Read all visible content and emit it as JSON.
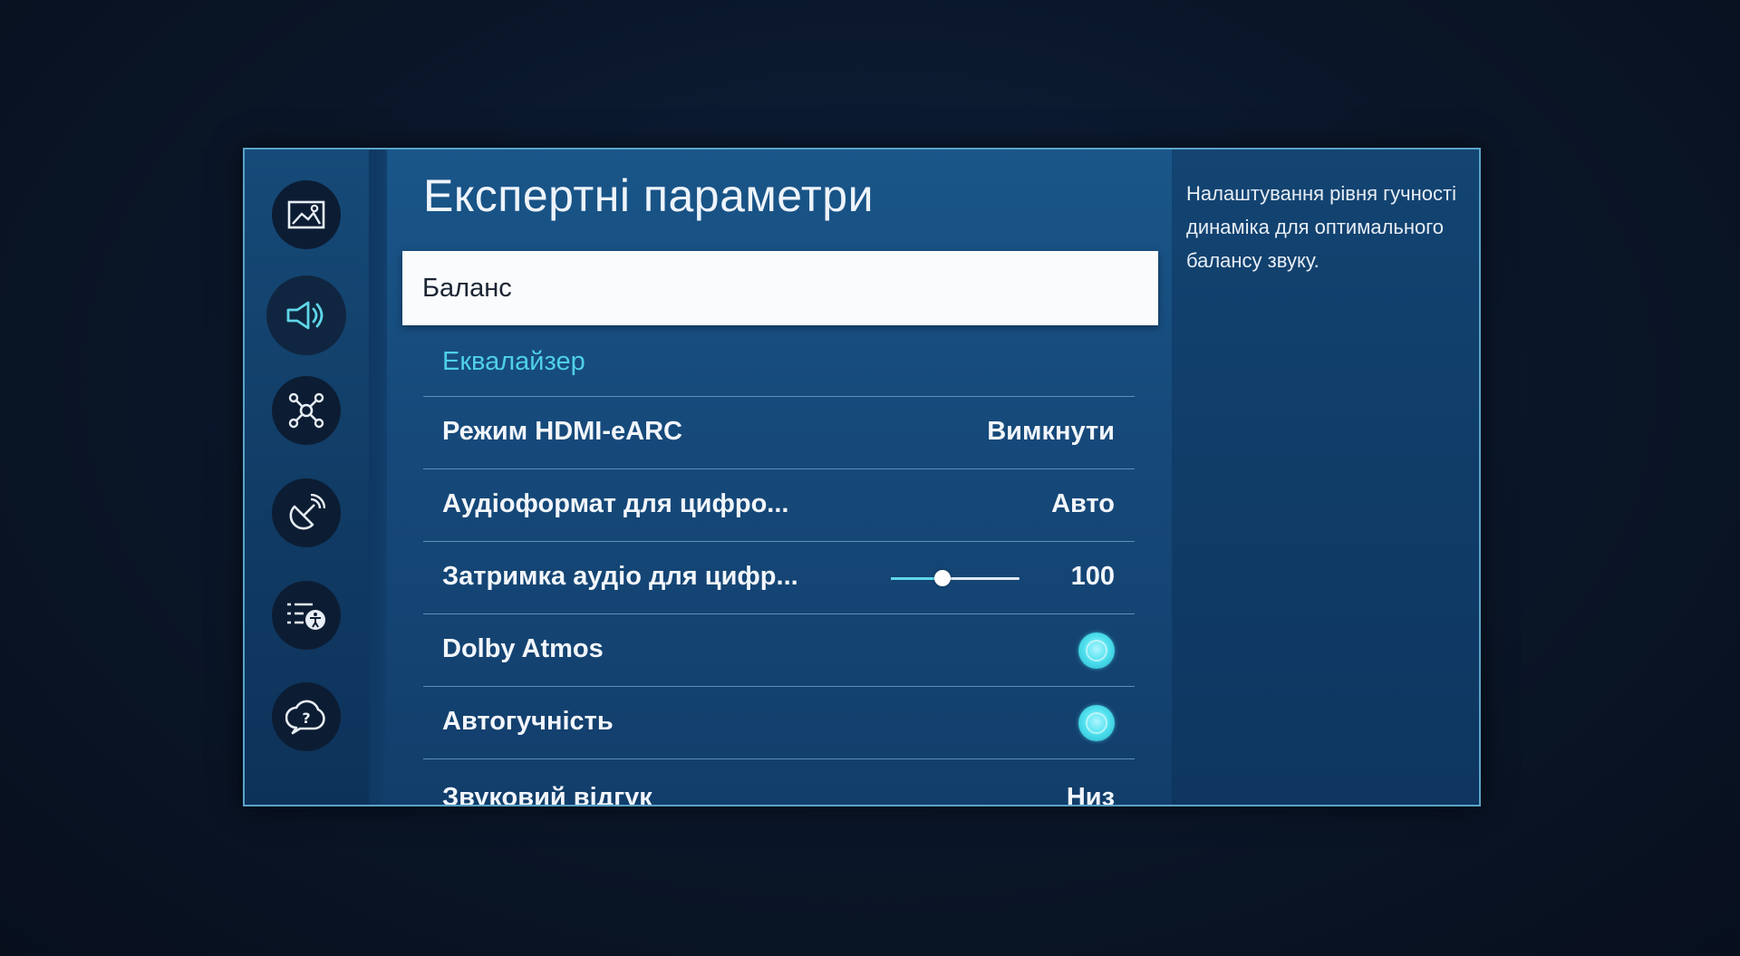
{
  "sidebar": {
    "items": [
      {
        "icon": "picture-icon",
        "active": false
      },
      {
        "icon": "sound-icon",
        "active": true
      },
      {
        "icon": "connection-icon",
        "active": false
      },
      {
        "icon": "broadcast-icon",
        "active": false
      },
      {
        "icon": "accessibility-icon",
        "active": false
      },
      {
        "icon": "support-icon",
        "active": false
      }
    ]
  },
  "main": {
    "title": "Експертні параметри",
    "focused_item": "Баланс",
    "section_label": "Еквалайзер",
    "rows": [
      {
        "label": "Режим HDMI-eARC",
        "value": "Вимкнути"
      },
      {
        "label": "Аудіоформат для цифро...",
        "value": "Авто"
      },
      {
        "label": "Затримка аудіо для цифр...",
        "value": "100",
        "slider_fraction": 0.4
      },
      {
        "label": "Dolby Atmos",
        "toggle": true
      },
      {
        "label": "Автогучність",
        "toggle": true
      },
      {
        "label": "Звуковий відгук",
        "value": "Низ"
      }
    ]
  },
  "description": {
    "text": "Налаштування рівня гучності динаміка для оптимального балансу звуку."
  },
  "colors": {
    "accent": "#4fd0e6",
    "toggle_on": "#52e2ef",
    "focus_bg": "#fafbfc"
  }
}
